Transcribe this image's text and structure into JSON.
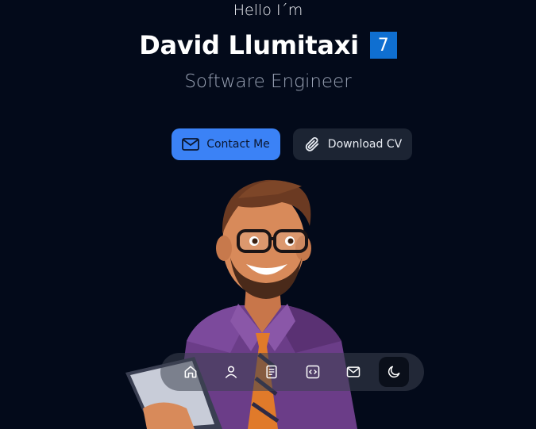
{
  "hero": {
    "greeting": "Hello I´m",
    "name": "David Llumitaxi",
    "badge": "7",
    "role": "Software Engineer"
  },
  "actions": {
    "contact_label": "Contact Me",
    "download_label": "Download CV"
  },
  "dock": {
    "items": [
      {
        "icon": "home-icon"
      },
      {
        "icon": "user-icon"
      },
      {
        "icon": "document-icon"
      },
      {
        "icon": "code-icon"
      },
      {
        "icon": "mail-icon"
      },
      {
        "icon": "moon-icon",
        "active": true
      }
    ]
  },
  "colors": {
    "background": "#030a1a",
    "accent": "#3b82f6",
    "secondary_button": "#1c2433",
    "badge": "#0f6fd1"
  }
}
